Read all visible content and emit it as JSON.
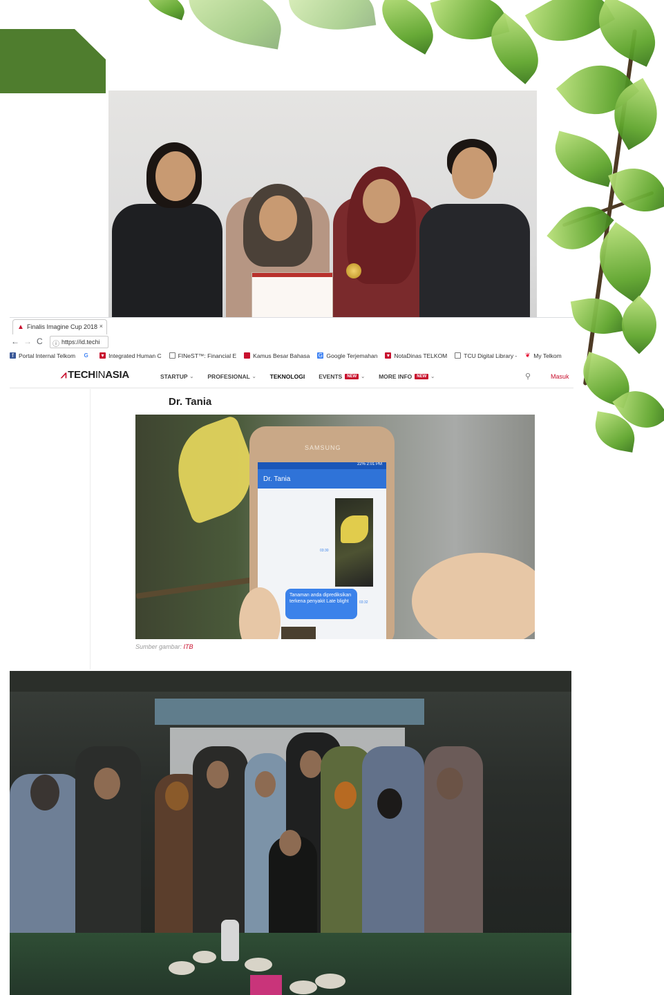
{
  "browser": {
    "tab_title": "Finalis Imagine Cup 2018",
    "tab_close": "×",
    "nav": {
      "back": "←",
      "forward": "→",
      "reload": "C"
    },
    "url": "https://id.techi",
    "bookmarks": [
      {
        "label": "Portal Internal Telkom",
        "icon": "facebook-icon",
        "color": "#3b5998"
      },
      {
        "label": "Integrated Human C",
        "icon": "google-icon",
        "color": "#4285f4"
      },
      {
        "label": "FINeST™: Financial E",
        "icon": "page-icon",
        "color": "#777777"
      },
      {
        "label": "Kamus Besar Bahasa",
        "icon": "book-icon",
        "color": "#c8102e"
      },
      {
        "label": "Google Terjemahan",
        "icon": "translate-icon",
        "color": "#4285f4"
      },
      {
        "label": "NotaDinas TELKOM",
        "icon": "shield-icon",
        "color": "#c8102e"
      },
      {
        "label": "TCU Digital Library -",
        "icon": "page-icon",
        "color": "#777777"
      },
      {
        "label": "My Telkom",
        "icon": "telkom-icon",
        "color": "#e4002b"
      }
    ]
  },
  "site": {
    "logo_left": "TECH",
    "logo_mid": "IN",
    "logo_right": "ASIA",
    "menu": [
      {
        "label": "STARTUP",
        "caret": true,
        "badge": ""
      },
      {
        "label": "PROFESIONAL",
        "caret": true,
        "badge": ""
      },
      {
        "label": "TEKNOLOGI",
        "caret": false,
        "badge": ""
      },
      {
        "label": "EVENTS",
        "caret": true,
        "badge": "NEW"
      },
      {
        "label": "MORE INFO",
        "caret": true,
        "badge": "NEW"
      }
    ],
    "login": "Masuk"
  },
  "article": {
    "title": "Dr. Tania",
    "caption_prefix": "Sumber gambar:",
    "caption_source": "ITB"
  },
  "phone": {
    "brand": "SAMSUNG",
    "status": "22% 2:01 PM",
    "app_title": "Dr. Tania",
    "message": "Tanaman anda diprediksikan terkena penyakit Late blight",
    "time_image": "03:30",
    "time_message": "03:32"
  },
  "colors": {
    "accent_green": "#4f7d2e",
    "techinasia_red": "#c8102e",
    "chat_blue": "#3b82ea"
  }
}
